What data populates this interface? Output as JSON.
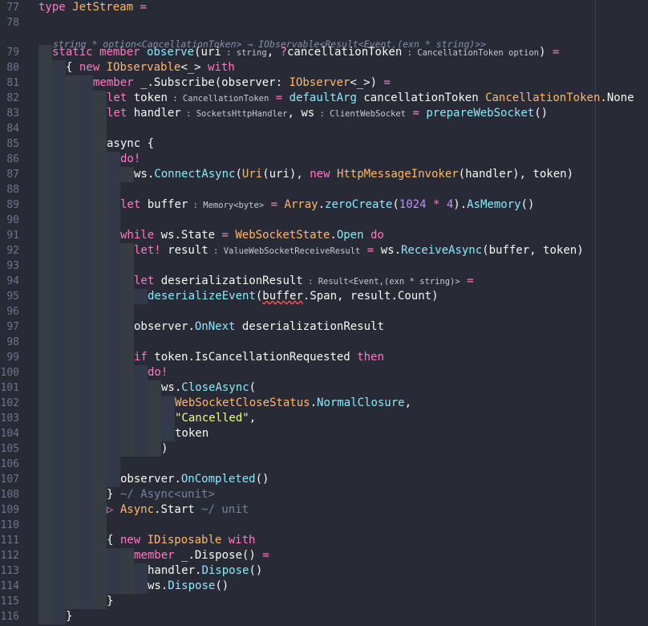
{
  "editor": {
    "language": "F#",
    "lens_signature": "string * option<CancellationToken> → IObservable<Result<Event,(exn * string)>>",
    "lines": [
      {
        "num": "77",
        "indent": 0,
        "tokens": [
          [
            "kw",
            "type"
          ],
          [
            "id",
            " "
          ],
          [
            "ty",
            "JetStream"
          ],
          [
            "id",
            " "
          ],
          [
            "op",
            "="
          ]
        ]
      },
      {
        "num": "78",
        "indent": 0,
        "tokens": []
      },
      {
        "num": "79",
        "indent": 1,
        "tokens": [
          [
            "kw",
            "static"
          ],
          [
            "id",
            " "
          ],
          [
            "kw",
            "member"
          ],
          [
            "id",
            " "
          ],
          [
            "fn",
            "observe"
          ],
          [
            "pu",
            "("
          ],
          [
            "id",
            "uri"
          ],
          [
            "hn",
            " : string"
          ],
          [
            "pu",
            ", "
          ],
          [
            "op",
            "?"
          ],
          [
            "id",
            "cancellationToken"
          ],
          [
            "hn",
            " : CancellationToken option"
          ],
          [
            "pu",
            ")"
          ],
          [
            "id",
            " "
          ],
          [
            "op",
            "="
          ]
        ]
      },
      {
        "num": "80",
        "indent": 2,
        "tokens": [
          [
            "pu",
            "{ "
          ],
          [
            "kw",
            "new"
          ],
          [
            "id",
            " "
          ],
          [
            "ty",
            "IObservable"
          ],
          [
            "pu",
            "<_>"
          ],
          [
            "id",
            " "
          ],
          [
            "kw",
            "with"
          ]
        ]
      },
      {
        "num": "81",
        "indent": 4,
        "tokens": [
          [
            "kw",
            "member"
          ],
          [
            "id",
            " "
          ],
          [
            "pu",
            "_."
          ],
          [
            "id",
            "Subscribe"
          ],
          [
            "pu",
            "("
          ],
          [
            "id",
            "observer"
          ],
          [
            "pu",
            ": "
          ],
          [
            "ty",
            "IObserver"
          ],
          [
            "pu",
            "<_>)"
          ],
          [
            "id",
            " "
          ],
          [
            "op",
            "="
          ]
        ]
      },
      {
        "num": "82",
        "indent": 5,
        "tokens": [
          [
            "kw",
            "let"
          ],
          [
            "id",
            " token"
          ],
          [
            "hn",
            " : CancellationToken"
          ],
          [
            "id",
            " "
          ],
          [
            "op",
            "="
          ],
          [
            "id",
            " "
          ],
          [
            "fn",
            "defaultArg"
          ],
          [
            "id",
            " cancellationToken "
          ],
          [
            "ty",
            "CancellationToken"
          ],
          [
            "pu",
            "."
          ],
          [
            "id",
            "None"
          ]
        ]
      },
      {
        "num": "83",
        "indent": 5,
        "tokens": [
          [
            "kw",
            "let"
          ],
          [
            "id",
            " handler"
          ],
          [
            "hn",
            " : SocketsHttpHandler"
          ],
          [
            "pu",
            ", "
          ],
          [
            "id",
            "ws"
          ],
          [
            "hn",
            " : ClientWebSocket"
          ],
          [
            "id",
            " "
          ],
          [
            "op",
            "="
          ],
          [
            "id",
            " "
          ],
          [
            "fn",
            "prepareWebSocket"
          ],
          [
            "pu",
            "()"
          ]
        ]
      },
      {
        "num": "84",
        "indent": 5,
        "tokens": []
      },
      {
        "num": "85",
        "indent": 5,
        "tokens": [
          [
            "id",
            "async"
          ],
          [
            "id",
            " "
          ],
          [
            "pu",
            "{"
          ]
        ]
      },
      {
        "num": "86",
        "indent": 6,
        "tokens": [
          [
            "kw",
            "do!"
          ]
        ]
      },
      {
        "num": "87",
        "indent": 7,
        "tokens": [
          [
            "id",
            "ws"
          ],
          [
            "pu",
            "."
          ],
          [
            "fn",
            "ConnectAsync"
          ],
          [
            "pu",
            "("
          ],
          [
            "ty",
            "Uri"
          ],
          [
            "pu",
            "("
          ],
          [
            "id",
            "uri"
          ],
          [
            "pu",
            "), "
          ],
          [
            "kw",
            "new"
          ],
          [
            "id",
            " "
          ],
          [
            "ty",
            "HttpMessageInvoker"
          ],
          [
            "pu",
            "("
          ],
          [
            "id",
            "handler"
          ],
          [
            "pu",
            "), "
          ],
          [
            "id",
            "token"
          ],
          [
            "pu",
            ")"
          ]
        ]
      },
      {
        "num": "88",
        "indent": 6,
        "tokens": []
      },
      {
        "num": "89",
        "indent": 6,
        "tokens": [
          [
            "kw",
            "let"
          ],
          [
            "id",
            " buffer"
          ],
          [
            "hn",
            " : Memory<byte>"
          ],
          [
            "id",
            " "
          ],
          [
            "op",
            "="
          ],
          [
            "id",
            " "
          ],
          [
            "ty",
            "Array"
          ],
          [
            "pu",
            "."
          ],
          [
            "fn",
            "zeroCreate"
          ],
          [
            "pu",
            "("
          ],
          [
            "nm",
            "1024"
          ],
          [
            "id",
            " "
          ],
          [
            "op",
            "*"
          ],
          [
            "id",
            " "
          ],
          [
            "nm",
            "4"
          ],
          [
            "pu",
            ")."
          ],
          [
            "fn",
            "AsMemory"
          ],
          [
            "pu",
            "()"
          ]
        ]
      },
      {
        "num": "90",
        "indent": 6,
        "tokens": []
      },
      {
        "num": "91",
        "indent": 6,
        "tokens": [
          [
            "kw",
            "while"
          ],
          [
            "id",
            " ws"
          ],
          [
            "pu",
            "."
          ],
          [
            "id",
            "State"
          ],
          [
            "id",
            " "
          ],
          [
            "op",
            "="
          ],
          [
            "id",
            " "
          ],
          [
            "ty",
            "WebSocketState"
          ],
          [
            "pu",
            "."
          ],
          [
            "fn",
            "Open"
          ],
          [
            "id",
            " "
          ],
          [
            "kw",
            "do"
          ]
        ]
      },
      {
        "num": "92",
        "indent": 7,
        "tokens": [
          [
            "kw",
            "let!"
          ],
          [
            "id",
            " result"
          ],
          [
            "hn",
            " : ValueWebSocketReceiveResult"
          ],
          [
            "id",
            " "
          ],
          [
            "op",
            "="
          ],
          [
            "id",
            " ws"
          ],
          [
            "pu",
            "."
          ],
          [
            "fn",
            "ReceiveAsync"
          ],
          [
            "pu",
            "("
          ],
          [
            "id",
            "buffer"
          ],
          [
            "pu",
            ", "
          ],
          [
            "id",
            "token"
          ],
          [
            "pu",
            ")"
          ]
        ]
      },
      {
        "num": "93",
        "indent": 7,
        "tokens": []
      },
      {
        "num": "94",
        "indent": 7,
        "tokens": [
          [
            "kw",
            "let"
          ],
          [
            "id",
            " deserializationResult"
          ],
          [
            "hn",
            " : Result<Event,(exn * string)>"
          ],
          [
            "id",
            " "
          ],
          [
            "op",
            "="
          ]
        ]
      },
      {
        "num": "95",
        "indent": 8,
        "tokens": [
          [
            "fn",
            "deserializeEvent"
          ],
          [
            "pu",
            "("
          ],
          [
            "sq",
            "buffer"
          ],
          [
            "pu",
            "."
          ],
          [
            "id",
            "Span"
          ],
          [
            "pu",
            ", "
          ],
          [
            "id",
            "result"
          ],
          [
            "pu",
            "."
          ],
          [
            "id",
            "Count"
          ],
          [
            "pu",
            ")"
          ]
        ]
      },
      {
        "num": "96",
        "indent": 7,
        "tokens": []
      },
      {
        "num": "97",
        "indent": 7,
        "tokens": [
          [
            "id",
            "observer"
          ],
          [
            "pu",
            "."
          ],
          [
            "fn",
            "OnNext"
          ],
          [
            "id",
            " deserializationResult"
          ]
        ]
      },
      {
        "num": "98",
        "indent": 7,
        "tokens": []
      },
      {
        "num": "99",
        "indent": 7,
        "tokens": [
          [
            "kw",
            "if"
          ],
          [
            "id",
            " token"
          ],
          [
            "pu",
            "."
          ],
          [
            "id",
            "IsCancellationRequested"
          ],
          [
            "id",
            " "
          ],
          [
            "kw",
            "then"
          ]
        ]
      },
      {
        "num": "100",
        "indent": 8,
        "tokens": [
          [
            "kw",
            "do!"
          ]
        ]
      },
      {
        "num": "101",
        "indent": 9,
        "tokens": [
          [
            "id",
            "ws"
          ],
          [
            "pu",
            "."
          ],
          [
            "fn",
            "CloseAsync"
          ],
          [
            "pu",
            "("
          ]
        ]
      },
      {
        "num": "102",
        "indent": 10,
        "tokens": [
          [
            "ty",
            "WebSocketCloseStatus"
          ],
          [
            "pu",
            "."
          ],
          [
            "fn",
            "NormalClosure"
          ],
          [
            "pu",
            ","
          ]
        ]
      },
      {
        "num": "103",
        "indent": 10,
        "tokens": [
          [
            "st",
            "\"Cancelled\""
          ],
          [
            "pu",
            ","
          ]
        ]
      },
      {
        "num": "104",
        "indent": 10,
        "tokens": [
          [
            "id",
            "token"
          ]
        ]
      },
      {
        "num": "105",
        "indent": 9,
        "tokens": [
          [
            "pu",
            ")"
          ]
        ]
      },
      {
        "num": "106",
        "indent": 6,
        "tokens": []
      },
      {
        "num": "107",
        "indent": 6,
        "tokens": [
          [
            "id",
            "observer"
          ],
          [
            "pu",
            "."
          ],
          [
            "fn",
            "OnCompleted"
          ],
          [
            "pu",
            "()"
          ]
        ]
      },
      {
        "num": "108",
        "indent": 5,
        "tokens": [
          [
            "pu",
            "}"
          ],
          [
            "cm",
            " ~/ Async<unit>"
          ]
        ]
      },
      {
        "num": "109",
        "indent": 5,
        "tokens": [
          [
            "op",
            "▷"
          ],
          [
            "id",
            " "
          ],
          [
            "ty",
            "Async"
          ],
          [
            "pu",
            "."
          ],
          [
            "id",
            "Start"
          ],
          [
            "cm",
            " ~/ unit"
          ]
        ]
      },
      {
        "num": "110",
        "indent": 5,
        "tokens": []
      },
      {
        "num": "111",
        "indent": 5,
        "tokens": [
          [
            "pu",
            "{ "
          ],
          [
            "kw",
            "new"
          ],
          [
            "id",
            " "
          ],
          [
            "ty",
            "IDisposable"
          ],
          [
            "id",
            " "
          ],
          [
            "kw",
            "with"
          ]
        ]
      },
      {
        "num": "112",
        "indent": 7,
        "tokens": [
          [
            "kw",
            "member"
          ],
          [
            "id",
            " "
          ],
          [
            "pu",
            "_."
          ],
          [
            "id",
            "Dispose"
          ],
          [
            "pu",
            "()"
          ],
          [
            "id",
            " "
          ],
          [
            "op",
            "="
          ]
        ]
      },
      {
        "num": "113",
        "indent": 8,
        "tokens": [
          [
            "id",
            "handler"
          ],
          [
            "pu",
            "."
          ],
          [
            "fn",
            "Dispose"
          ],
          [
            "pu",
            "()"
          ]
        ]
      },
      {
        "num": "114",
        "indent": 8,
        "tokens": [
          [
            "id",
            "ws"
          ],
          [
            "pu",
            "."
          ],
          [
            "fn",
            "Dispose"
          ],
          [
            "pu",
            "()"
          ]
        ]
      },
      {
        "num": "115",
        "indent": 5,
        "tokens": [
          [
            "pu",
            "}"
          ]
        ]
      },
      {
        "num": "116",
        "indent": 2,
        "tokens": [
          [
            "pu",
            "}"
          ]
        ]
      }
    ]
  }
}
